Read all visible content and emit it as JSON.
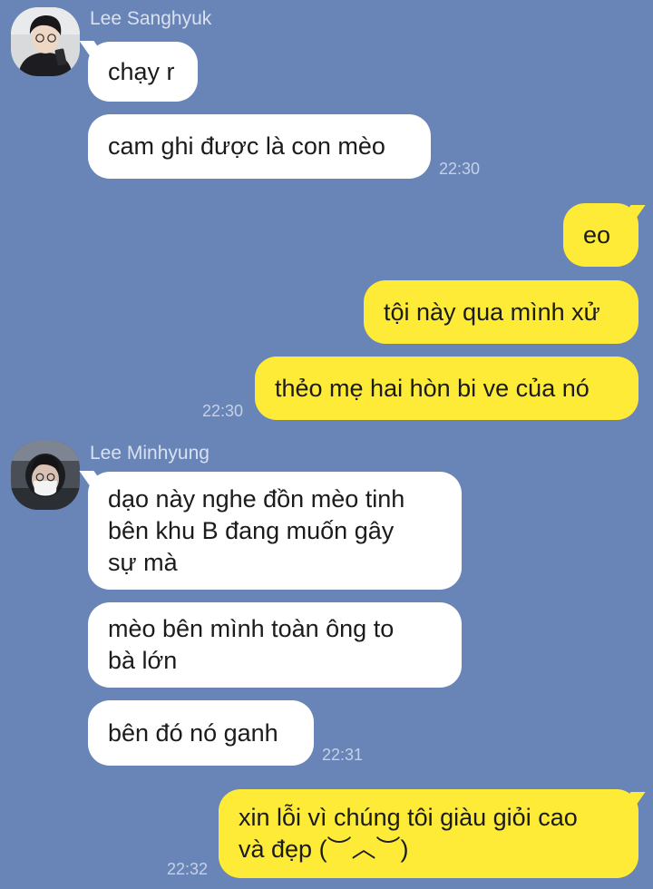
{
  "colors": {
    "background": "#6985b7",
    "incoming_bubble": "#ffffff",
    "outgoing_bubble": "#fdeb38",
    "sender_name": "#d8e1f0",
    "timestamp": "#c5d1e6"
  },
  "groups": [
    {
      "sender": "Lee Sanghyuk",
      "messages": [
        "chạy r",
        "cam ghi được là con mèo"
      ],
      "time": "22:30"
    },
    {
      "sender": "",
      "messages": [
        "eo",
        "tội này qua mình xử",
        "thẻo mẹ hai hòn bi ve của nó"
      ],
      "time": "22:30"
    },
    {
      "sender": "Lee Minhyung",
      "messages": [
        "dạo này nghe đồn mèo tinh\nbên khu B đang muốn gây\nsự mà",
        "mèo bên mình toàn ông to\nbà lớn",
        "bên đó nó ganh"
      ],
      "time": "22:31"
    },
    {
      "sender": "",
      "messages": [
        "xin lỗi vì chúng tôi giàu giỏi cao\nvà đẹp (︶︿︶)"
      ],
      "time": "22:32"
    }
  ]
}
